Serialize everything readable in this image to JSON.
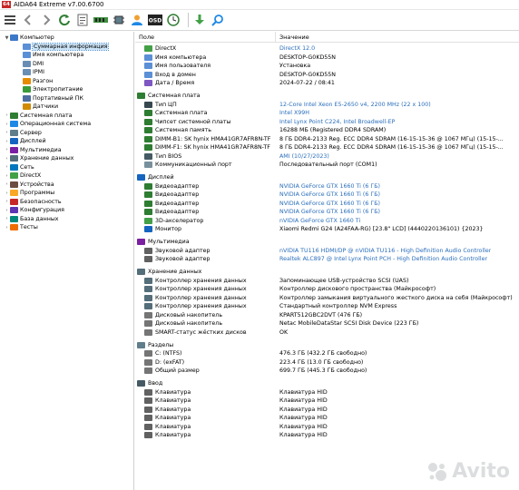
{
  "window": {
    "logo_text": "64",
    "title": "AIDA64 Extreme v7.00.6700"
  },
  "toolbar": {
    "buttons": [
      "menu-icon",
      "back-icon",
      "forward-icon",
      "refresh-icon",
      "report-icon",
      "memory-icon",
      "chip-icon",
      "user-icon",
      "osd-icon",
      "clock-icon",
      "download-icon",
      "search-icon"
    ],
    "osd_label": "OSD"
  },
  "tree": {
    "items": [
      {
        "label": "Компьютер",
        "exp": "▼",
        "indent": 0,
        "color": "#3c78c8"
      },
      {
        "label": "Суммарная информация",
        "exp": "",
        "indent": 1,
        "color": "#5b8fd6",
        "selected": true
      },
      {
        "label": "Имя компьютера",
        "exp": "",
        "indent": 1,
        "color": "#5b8fd6"
      },
      {
        "label": "DMI",
        "exp": "",
        "indent": 1,
        "color": "#6a8db5"
      },
      {
        "label": "IPMI",
        "exp": "",
        "indent": 1,
        "color": "#6a8db5"
      },
      {
        "label": "Разгон",
        "exp": "",
        "indent": 1,
        "color": "#e68a00"
      },
      {
        "label": "Электропитание",
        "exp": "",
        "indent": 1,
        "color": "#3a9a3a"
      },
      {
        "label": "Портативный ПК",
        "exp": "",
        "indent": 1,
        "color": "#4d6e9e"
      },
      {
        "label": "Датчики",
        "exp": "",
        "indent": 1,
        "color": "#d08b00"
      },
      {
        "label": "Системная плата",
        "exp": "›",
        "indent": 0,
        "color": "#2f7d32"
      },
      {
        "label": "Операционная система",
        "exp": "›",
        "indent": 0,
        "color": "#1e88e5"
      },
      {
        "label": "Сервер",
        "exp": "›",
        "indent": 0,
        "color": "#607d8b"
      },
      {
        "label": "Дисплей",
        "exp": "›",
        "indent": 0,
        "color": "#1565c0"
      },
      {
        "label": "Мультимедиа",
        "exp": "›",
        "indent": 0,
        "color": "#7b1fa2"
      },
      {
        "label": "Хранение данных",
        "exp": "›",
        "indent": 0,
        "color": "#546e7a"
      },
      {
        "label": "Сеть",
        "exp": "›",
        "indent": 0,
        "color": "#0277bd"
      },
      {
        "label": "DirectX",
        "exp": "›",
        "indent": 0,
        "color": "#43a047"
      },
      {
        "label": "Устройства",
        "exp": "›",
        "indent": 0,
        "color": "#6d4c41"
      },
      {
        "label": "Программы",
        "exp": "›",
        "indent": 0,
        "color": "#f9a825"
      },
      {
        "label": "Безопасность",
        "exp": "›",
        "indent": 0,
        "color": "#c62828"
      },
      {
        "label": "Конфигурация",
        "exp": "›",
        "indent": 0,
        "color": "#5e35b1"
      },
      {
        "label": "База данных",
        "exp": "›",
        "indent": 0,
        "color": "#00897b"
      },
      {
        "label": "Тесты",
        "exp": "›",
        "indent": 0,
        "color": "#ef6c00"
      }
    ]
  },
  "table": {
    "col_field": "Поле",
    "col_value": "Значение",
    "groups": [
      {
        "title": "",
        "icon_color": "",
        "rows": [
          {
            "field": "DirectX",
            "value": "DirectX 12.0",
            "link": true,
            "color": "#43a047"
          },
          {
            "field": "Имя компьютера",
            "value": "DESKTOP-G0KD55N",
            "link": false,
            "color": "#5b8fd6"
          },
          {
            "field": "Имя пользователя",
            "value": "Установка",
            "link": false,
            "color": "#5b8fd6"
          },
          {
            "field": "Вход в домен",
            "value": "DESKTOP-G0KD55N",
            "link": false,
            "color": "#5b8fd6"
          },
          {
            "field": "Дата / Время",
            "value": "2024-07-22 / 08:41",
            "link": false,
            "color": "#7e57c2"
          }
        ]
      },
      {
        "title": "Системная плата",
        "icon_color": "#2f7d32",
        "rows": [
          {
            "field": "Тип ЦП",
            "value": "12-Core Intel Xeon E5-2650 v4, 2200 MHz (22 x 100)",
            "link": true,
            "color": "#37474f"
          },
          {
            "field": "Системная плата",
            "value": "Intel X99H",
            "link": true,
            "color": "#2f7d32"
          },
          {
            "field": "Чипсет системной платы",
            "value": "Intel Lynx Point C224, Intel Broadwell-EP",
            "link": true,
            "color": "#2f7d32"
          },
          {
            "field": "Системная память",
            "value": "16288 МБ  (Registered DDR4 SDRAM)",
            "link": false,
            "color": "#2f7d32"
          },
          {
            "field": "DIMM-B1: SK hynix HMA41GR7AFR8N-TF",
            "value": "8 ГБ DDR4-2133 Reg. ECC DDR4 SDRAM  (16-15-15-36 @ 1067 МГц)  (15-15-...",
            "link": false,
            "color": "#2f7d32"
          },
          {
            "field": "DIMM-F1: SK hynix HMA41GR7AFR8N-TF",
            "value": "8 ГБ DDR4-2133 Reg. ECC DDR4 SDRAM  (16-15-15-36 @ 1067 МГц)  (15-15-...",
            "link": false,
            "color": "#2f7d32"
          },
          {
            "field": "Тип BIOS",
            "value": "AMI (10/27/2023)",
            "link": true,
            "color": "#455a64"
          },
          {
            "field": "Коммуникационный порт",
            "value": "Последовательный порт (COM1)",
            "link": false,
            "color": "#78909c"
          }
        ]
      },
      {
        "title": "Дисплей",
        "icon_color": "#1565c0",
        "rows": [
          {
            "field": "Видеоадаптер",
            "value": "NVIDIA GeForce GTX 1660 Ti  (6 ГБ)",
            "link": true,
            "color": "#2e7d32"
          },
          {
            "field": "Видеоадаптер",
            "value": "NVIDIA GeForce GTX 1660 Ti  (6 ГБ)",
            "link": true,
            "color": "#2e7d32"
          },
          {
            "field": "Видеоадаптер",
            "value": "NVIDIA GeForce GTX 1660 Ti  (6 ГБ)",
            "link": true,
            "color": "#2e7d32"
          },
          {
            "field": "Видеоадаптер",
            "value": "NVIDIA GeForce GTX 1660 Ti  (6 ГБ)",
            "link": true,
            "color": "#2e7d32"
          },
          {
            "field": "3D-акселератор",
            "value": "nVIDIA GeForce GTX 1660 Ti",
            "link": true,
            "color": "#43a047"
          },
          {
            "field": "Монитор",
            "value": "Xiaomi Redmi G24 (A24FAA-RG)  [23.8\" LCD]  (4440220136101)  {2023}",
            "link": false,
            "color": "#1565c0"
          }
        ]
      },
      {
        "title": "Мультимедиа",
        "icon_color": "#7b1fa2",
        "rows": [
          {
            "field": "Звуковой адаптер",
            "value": "nVIDIA TU116 HDMI/DP @ nVIDIA TU116 - High Definition Audio Controller",
            "link": true,
            "color": "#616161"
          },
          {
            "field": "Звуковой адаптер",
            "value": "Realtek ALC897 @ Intel Lynx Point PCH - High Definition Audio Controller",
            "link": true,
            "color": "#616161"
          }
        ]
      },
      {
        "title": "Хранение данных",
        "icon_color": "#546e7a",
        "rows": [
          {
            "field": "Контроллер хранения данных",
            "value": "Запоминающее USB-устройство SCSI (UAS)",
            "link": false,
            "color": "#546e7a"
          },
          {
            "field": "Контроллер хранения данных",
            "value": "Контроллер дискового пространства (Майкрософт)",
            "link": false,
            "color": "#546e7a"
          },
          {
            "field": "Контроллер хранения данных",
            "value": "Контроллер замыкания виртуального жесткого диска на себя (Майкрософт)",
            "link": false,
            "color": "#546e7a"
          },
          {
            "field": "Контроллер хранения данных",
            "value": "Стандартный контроллер NVM Express",
            "link": false,
            "color": "#546e7a"
          },
          {
            "field": "Дисковый накопитель",
            "value": "KPART512GBC2DVT  (476 ГБ)",
            "link": false,
            "color": "#757575"
          },
          {
            "field": "Дисковый накопитель",
            "value": "Netac MobileDataStar SCSI Disk Device  (223 ГБ)",
            "link": false,
            "color": "#757575"
          },
          {
            "field": "SMART-статус жёстких дисков",
            "value": "OK",
            "link": false,
            "color": "#757575"
          }
        ]
      },
      {
        "title": "Разделы",
        "icon_color": "#607d8b",
        "rows": [
          {
            "field": "C: (NTFS)",
            "value": "476.3 ГБ (432.2 ГБ свободно)",
            "link": false,
            "color": "#757575"
          },
          {
            "field": "D: (exFAT)",
            "value": "223.4 ГБ (13.0 ГБ свободно)",
            "link": false,
            "color": "#757575"
          },
          {
            "field": "Общий размер",
            "value": "699.7 ГБ (445.3 ГБ свободно)",
            "link": false,
            "color": "#757575"
          }
        ]
      },
      {
        "title": "Ввод",
        "icon_color": "#455a64",
        "rows": [
          {
            "field": "Клавиатура",
            "value": "Клавиатура HID",
            "link": false,
            "color": "#616161"
          },
          {
            "field": "Клавиатура",
            "value": "Клавиатура HID",
            "link": false,
            "color": "#616161"
          },
          {
            "field": "Клавиатура",
            "value": "Клавиатура HID",
            "link": false,
            "color": "#616161"
          },
          {
            "field": "Клавиатура",
            "value": "Клавиатура HID",
            "link": false,
            "color": "#616161"
          },
          {
            "field": "Клавиатура",
            "value": "Клавиатура HID",
            "link": false,
            "color": "#616161"
          },
          {
            "field": "Клавиатура",
            "value": "Клавиатура HID",
            "link": false,
            "color": "#616161"
          }
        ]
      }
    ]
  },
  "watermark": {
    "text": "Avito"
  }
}
